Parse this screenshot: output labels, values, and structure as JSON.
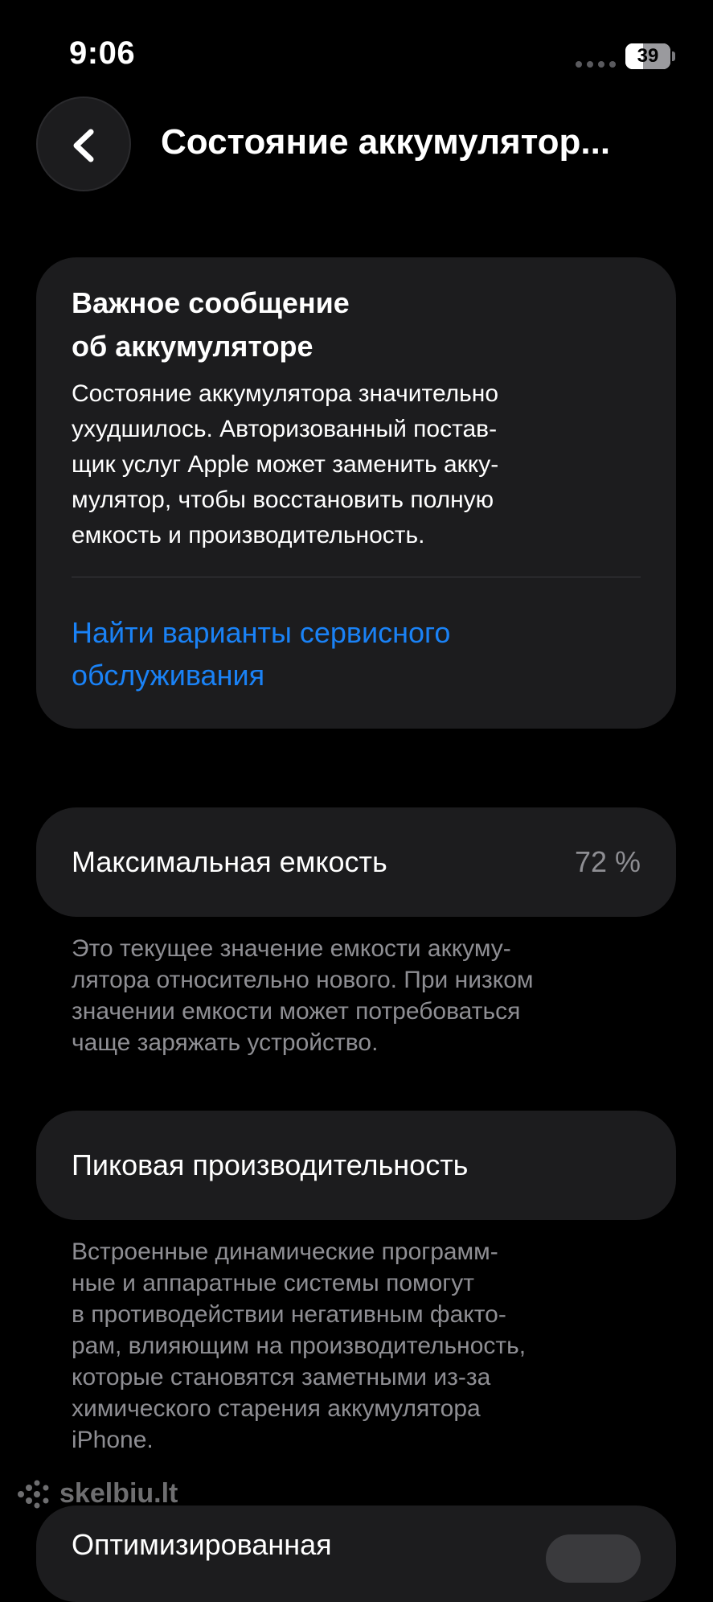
{
  "status_bar": {
    "time": "9:06",
    "battery_level": "39"
  },
  "header": {
    "title": "Состояние аккумулятор..."
  },
  "alert": {
    "title_line1": "Важное сообщение",
    "title_line2": "об аккумуляторе",
    "body_lines": [
      "Состояние аккумулятора значительно",
      "ухудшилось. Авторизованный постав-",
      "щик услуг Apple может заменить акку-",
      "мулятор, чтобы восстановить полную",
      "емкость и производительность."
    ],
    "link_line1": "Найти варианты сервисного",
    "link_line2": "обслуживания"
  },
  "max_capacity": {
    "label": "Максимальная емкость",
    "value": "72 %",
    "footnote_lines": [
      "Это текущее значение емкости аккуму-",
      "лятора относительно нового. При низком",
      "значении емкости может потребоваться",
      "чаще заряжать устройство."
    ]
  },
  "peak_performance": {
    "label": "Пиковая производительность",
    "footnote_lines": [
      "Встроенные динамические программ-",
      "ные и аппаратные системы помогут",
      "в противодействии негативным факто-",
      "рам, влияющим на производительность,",
      "которые становятся заметными из-за",
      "химического старения аккумулятора",
      "iPhone."
    ]
  },
  "optimized_charging": {
    "label": "Оптимизированная"
  },
  "watermark": {
    "text": "skelbiu.lt"
  },
  "colors": {
    "background": "#000000",
    "card": "#1c1c1e",
    "link": "#1a82f6",
    "secondary_text": "#8e8e93"
  },
  "icons": {
    "back": "chevron-left-icon",
    "signal": "signal-dots-icon",
    "battery": "battery-icon",
    "watermark_logo": "dots-logo-icon"
  }
}
